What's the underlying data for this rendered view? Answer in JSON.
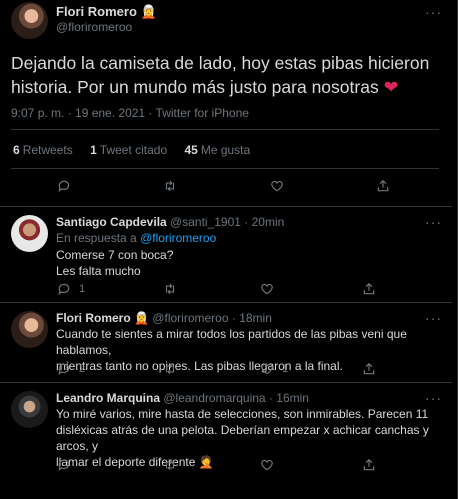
{
  "tweet": {
    "author_name": "Flori Romero",
    "author_emoji": "🧝",
    "author_handle": "@floriromeroo",
    "text": "Dejando la camiseta de lado, hoy estas pibas hicieron historia. Por un mundo más justo para nosotras",
    "heart_emoji": "❤",
    "meta": "9:07 p. m. · 19 ene. 2021 · Twitter for iPhone",
    "stats": [
      {
        "count": "6",
        "label": "Retweets"
      },
      {
        "count": "1",
        "label": "Tweet citado"
      },
      {
        "count": "45",
        "label": "Me gusta"
      }
    ],
    "more": "···"
  },
  "replies": [
    {
      "name": "Santiago Capdevila",
      "handle": "@santi_1901",
      "time": "· 20min",
      "reply_to_prefix": "En respuesta a ",
      "reply_to_handle": "@floriromeroo",
      "lines": [
        "Comerse 7 con boca?",
        "Les falta mucho"
      ],
      "reply_count": "1",
      "like_count": ""
    },
    {
      "name": "Flori Romero",
      "emoji": "🧝",
      "handle": "@floriromeroo",
      "time": "· 18min",
      "lines": [
        "Cuando te sientes a mirar todos los partidos de las pibas veni que hablamos,",
        "mientras tanto no opines. Las pibas llegaron a la final."
      ],
      "reply_count": "2",
      "like_count": "1"
    },
    {
      "name": "Leandro Marquina",
      "handle": "@leandromarquina",
      "time": "· 16min",
      "lines": [
        "Yo miré varios, mire hasta de selecciones, son inmirables. Parecen 11",
        "disléxicas atrás de una pelota. Deberían empezar x achicar canchas y arcos, y",
        "llamar el deporte diferente 🤦"
      ],
      "reply_count": "",
      "like_count": ""
    }
  ]
}
